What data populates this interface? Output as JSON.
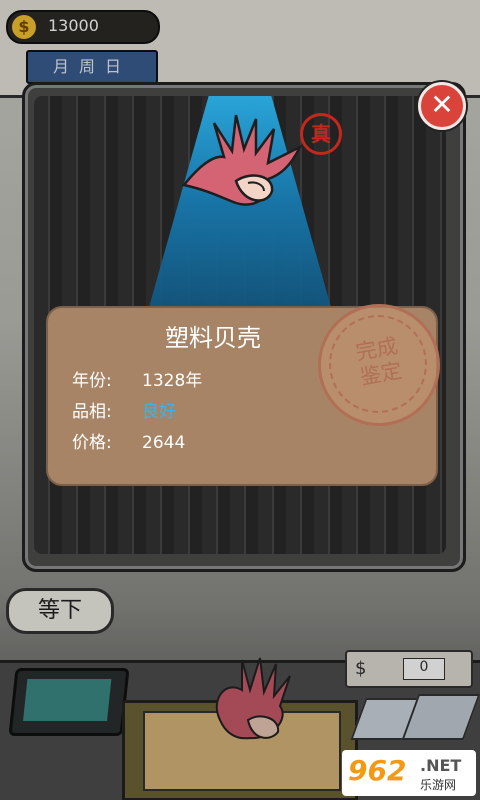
{
  "hud": {
    "money_symbol": "$",
    "money": "13000",
    "calendar": "月周日"
  },
  "actions": {
    "wait_label": "等下"
  },
  "register": {
    "currency_sign": "$",
    "value": "0"
  },
  "modal": {
    "close_glyph": "✕",
    "stamp_label": "真",
    "item": {
      "name": "塑料贝壳",
      "year_label": "年份:",
      "year_value": "1328年",
      "quality_label": "品相:",
      "quality_value": "良好",
      "price_label": "价格:",
      "price_value": "2644"
    },
    "seal_text": "完成\n鉴定"
  },
  "watermark": {
    "logo": "962",
    "suffix": ".NET",
    "site_name": "乐游网"
  },
  "colors": {
    "spotlight": "#1f8fc4",
    "card": "#a88466",
    "quality": "#35b6e8",
    "close_button": "#d9433a",
    "stamp": "#c3281d"
  },
  "icons": [
    "coin-icon",
    "close-icon",
    "shell-hand-icon",
    "authentic-stamp-icon",
    "appraisal-seal-icon"
  ]
}
